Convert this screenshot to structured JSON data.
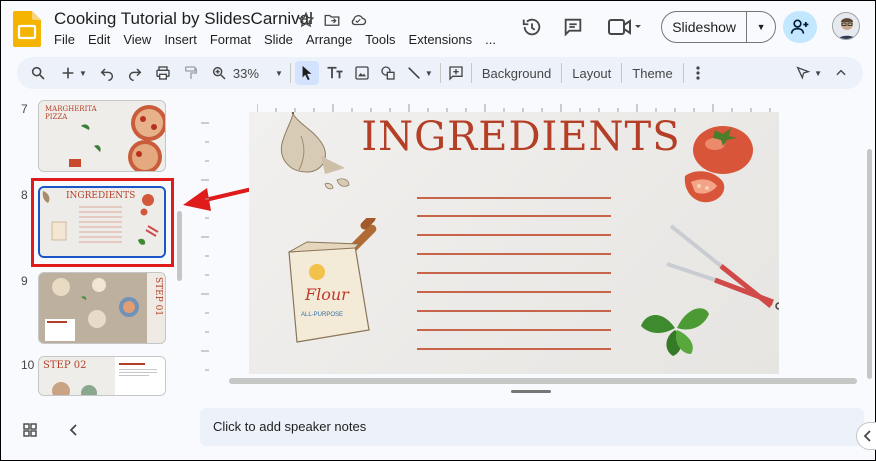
{
  "doc": {
    "title": "Cooking Tutorial by SlidesCarnival"
  },
  "menu": [
    "File",
    "Edit",
    "View",
    "Insert",
    "Format",
    "Slide",
    "Arrange",
    "Tools",
    "Extensions",
    "..."
  ],
  "header": {
    "slideshow_label": "Slideshow"
  },
  "toolbar": {
    "zoom": "33%",
    "background_label": "Background",
    "layout_label": "Layout",
    "theme_label": "Theme"
  },
  "filmstrip": {
    "slides": [
      {
        "num": "7",
        "title": "MARGHERITA PIZZA"
      },
      {
        "num": "8",
        "title": "INGREDIENTS"
      },
      {
        "num": "9",
        "title": "STEP 01"
      },
      {
        "num": "10",
        "title": "STEP 02"
      }
    ]
  },
  "slide": {
    "title": "INGREDIENTS",
    "flour_text": "Flour",
    "flour_sub": "ALL-PURPOSE"
  },
  "notes": {
    "placeholder": "Click to add speaker notes"
  },
  "colors": {
    "accent": "#b53f26",
    "selection": "#1a56c7",
    "annotation": "#e01b1b"
  }
}
